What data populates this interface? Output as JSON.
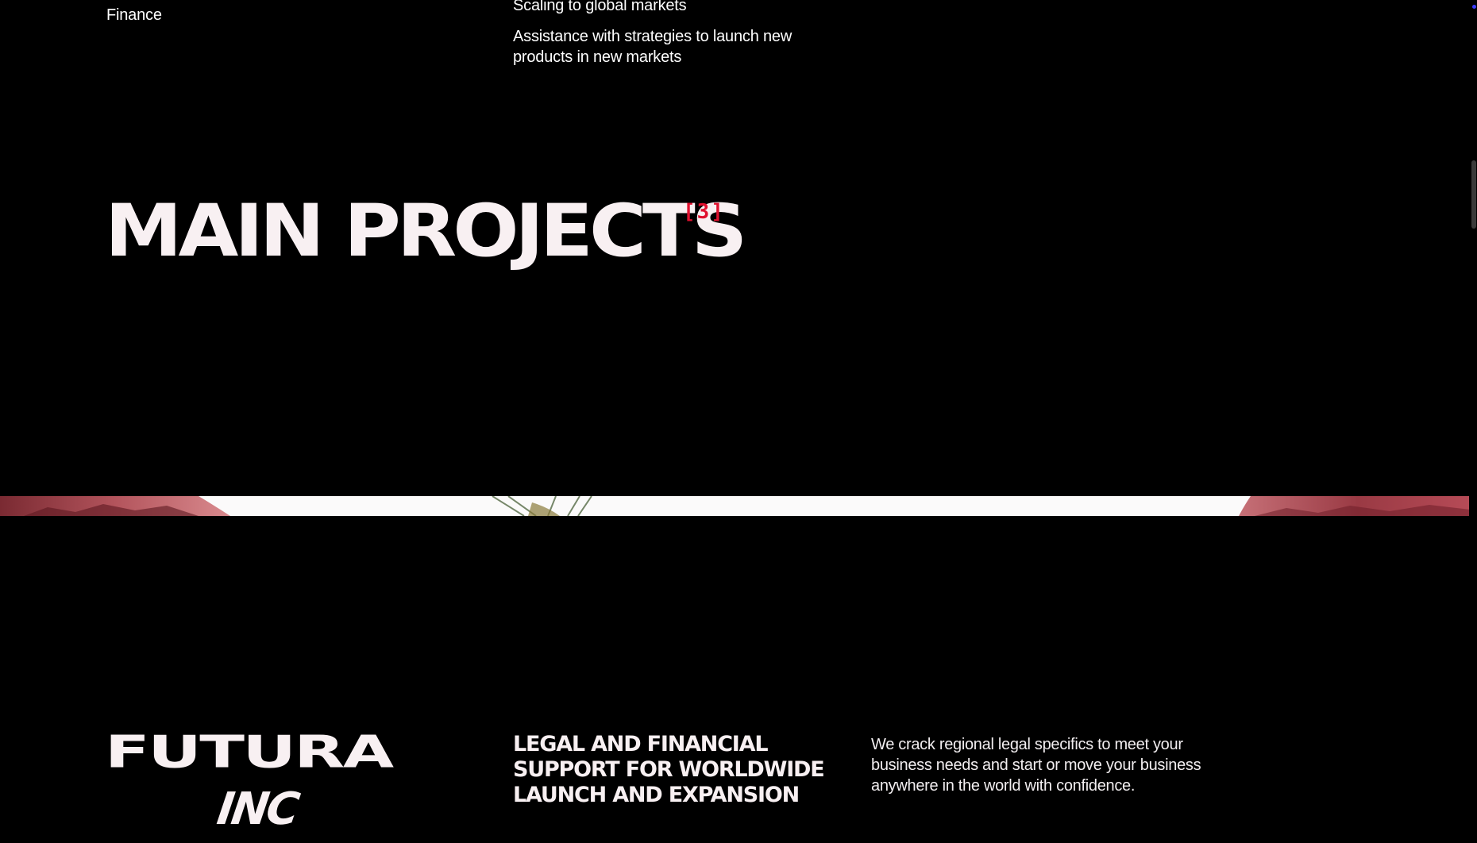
{
  "services": {
    "category": "Finance",
    "items": [
      "Scaling to global markets",
      "Assistance with strategies to launch new products in new markets"
    ]
  },
  "projects_section": {
    "title": "MAIN PROJECTS",
    "count": "[3]"
  },
  "project": {
    "logo_line1": "FUTURA",
    "logo_line2": "INC",
    "heading": "LEGAL AND FINANCIAL SUPPORT FOR WORLDWIDE LAUNCH AND EXPANSION",
    "description": "We crack regional legal specifics to meet your business needs and start or move your business anywhere in the world with confidence."
  },
  "colors": {
    "background": "#000000",
    "text": "#f8f0f2",
    "accent": "#e0102e"
  }
}
